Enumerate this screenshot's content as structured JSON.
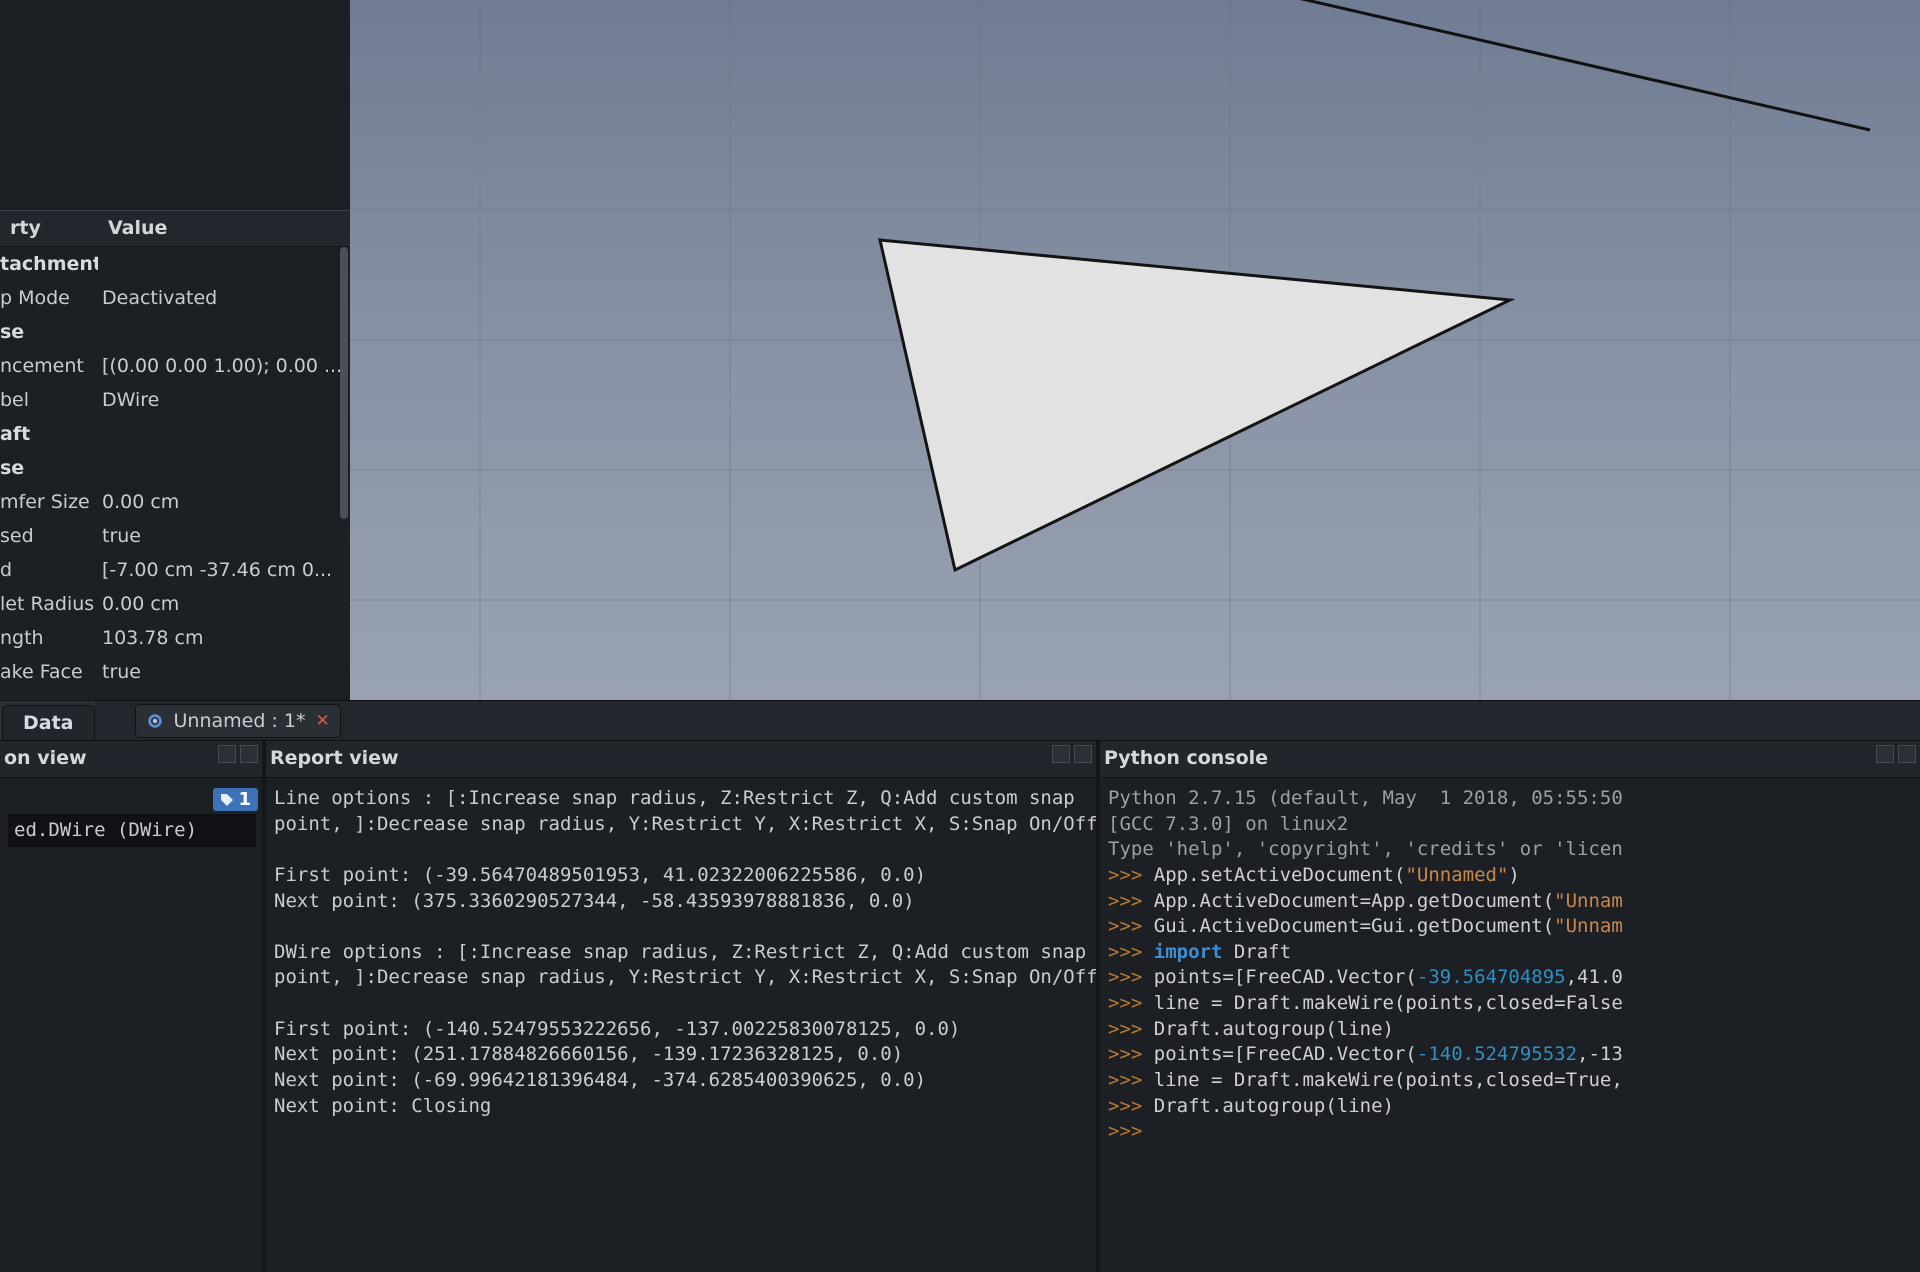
{
  "property_panel": {
    "header_left": "rty",
    "header_right": "Value",
    "rows": [
      {
        "k": "tachment",
        "v": "",
        "group": true
      },
      {
        "k": "p Mode",
        "v": "Deactivated"
      },
      {
        "k": "se",
        "v": "",
        "group": true
      },
      {
        "k": "ncement",
        "v": "[(0.00 0.00 1.00); 0.00 ..."
      },
      {
        "k": "bel",
        "v": "DWire"
      },
      {
        "k": "aft",
        "v": "",
        "group": true
      },
      {
        "k": "se",
        "v": "",
        "group": true
      },
      {
        "k": "mfer Size",
        "v": "0.00 cm"
      },
      {
        "k": "sed",
        "v": "true"
      },
      {
        "k": "d",
        "v": "[-7.00 cm  -37.46 cm  0..."
      },
      {
        "k": "let Radius",
        "v": "0.00 cm"
      },
      {
        "k": "ngth",
        "v": "103.78 cm"
      },
      {
        "k": "ake Face",
        "v": "true"
      }
    ],
    "data_tab_label": "Data"
  },
  "doc_tab": {
    "label": "Unnamed : 1*",
    "close": "✕"
  },
  "selection_view": {
    "title": "on view",
    "badge_count": "1",
    "item": "ed.DWire (DWire)"
  },
  "report_view": {
    "title": "Report view",
    "text": "Line options : [:Increase snap radius, Z:Restrict Z, Q:Add custom snap\npoint, ]:Decrease snap radius, Y:Restrict Y, X:Restrict X, S:Snap On/Off\n\nFirst point: (-39.56470489501953, 41.02322006225586, 0.0)\nNext point: (375.3360290527344, -58.43593978881836, 0.0)\n\nDWire options : [:Increase snap radius, Z:Restrict Z, Q:Add custom snap\npoint, ]:Decrease snap radius, Y:Restrict Y, X:Restrict X, S:Snap On/Off\n\nFirst point: (-140.52479553222656, -137.00225830078125, 0.0)\nNext point: (251.17884826660156, -139.17236328125, 0.0)\nNext point: (-69.99642181396484, -374.6285400390625, 0.0)\nNext point: Closing"
  },
  "python_console": {
    "title": "Python console",
    "lines": [
      {
        "kind": "info",
        "text": "Python 2.7.15 (default, May  1 2018, 05:55:50"
      },
      {
        "kind": "info",
        "text": "[GCC 7.3.0] on linux2"
      },
      {
        "kind": "info",
        "text": "Type 'help', 'copyright', 'credits' or 'licen"
      },
      {
        "kind": "code",
        "prompt": ">>> ",
        "pre": "App.setActiveDocument(",
        "str": "\"Unnamed\"",
        "post": ")"
      },
      {
        "kind": "code",
        "prompt": ">>> ",
        "pre": "App.ActiveDocument=App.getDocument(",
        "str": "\"Unnam",
        "post": ""
      },
      {
        "kind": "code",
        "prompt": ">>> ",
        "pre": "Gui.ActiveDocument=Gui.getDocument(",
        "str": "\"Unnam",
        "post": ""
      },
      {
        "kind": "import",
        "prompt": ">>> ",
        "kw": "import",
        "rest": " Draft"
      },
      {
        "kind": "code",
        "prompt": ">>> ",
        "pre": "points=[FreeCAD.Vector(",
        "num": "-39.564704895",
        "post": ",41.0"
      },
      {
        "kind": "code",
        "prompt": ">>> ",
        "pre": "line = Draft.makeWire(points,closed=False",
        "str": "",
        "post": ""
      },
      {
        "kind": "code",
        "prompt": ">>> ",
        "pre": "Draft.autogroup(line)",
        "str": "",
        "post": ""
      },
      {
        "kind": "code",
        "prompt": ">>> ",
        "pre": "points=[FreeCAD.Vector(",
        "num": "-140.524795532",
        "post": ",-13"
      },
      {
        "kind": "code",
        "prompt": ">>> ",
        "pre": "line = Draft.makeWire(points,closed=True,",
        "str": "",
        "post": ""
      },
      {
        "kind": "code",
        "prompt": ">>> ",
        "pre": "Draft.autogroup(line)",
        "str": "",
        "post": ""
      },
      {
        "kind": "code",
        "prompt": ">>> ",
        "pre": "",
        "str": "",
        "post": ""
      }
    ]
  }
}
